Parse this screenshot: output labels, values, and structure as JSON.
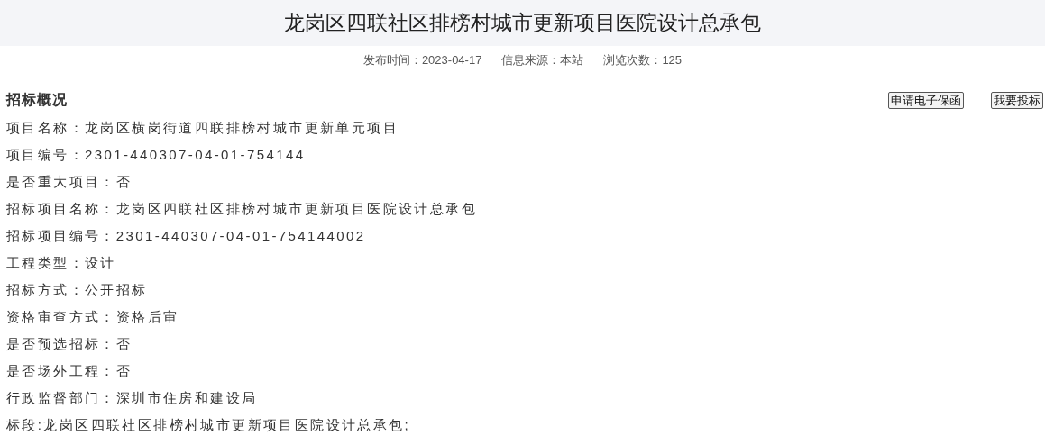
{
  "title": "龙岗区四联社区排榜村城市更新项目医院设计总承包",
  "meta": [
    "发布时间：2023-04-17",
    "信息来源：本站",
    "浏览次数：125"
  ],
  "section": {
    "heading": "招标概况",
    "buttons": [
      "申请电子保函",
      "我要投标"
    ]
  },
  "rows": [
    "项目名称：龙岗区横岗街道四联排榜村城市更新单元项目",
    "项目编号：2301-440307-04-01-754144",
    "是否重大项目：否",
    "招标项目名称：龙岗区四联社区排榜村城市更新项目医院设计总承包",
    "招标项目编号：2301-440307-04-01-754144002",
    "工程类型：设计",
    "招标方式：公开招标",
    "资格审查方式：资格后审",
    "是否预选招标：否",
    "是否场外工程：否",
    "行政监督部门：深圳市住房和建设局",
    "标段:龙岗区四联社区排榜村城市更新项目医院设计总承包;"
  ]
}
